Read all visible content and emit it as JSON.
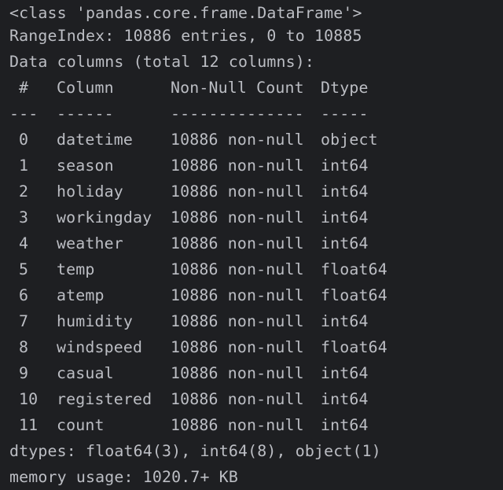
{
  "output": {
    "class_line": "<class 'pandas.core.frame.DataFrame'>",
    "range_index": "RangeIndex: 10886 entries, 0 to 10885",
    "data_columns": "Data columns (total 12 columns):",
    "headers": {
      "num": "#",
      "column": "Column",
      "count": "Non-Null Count",
      "dtype": "Dtype"
    },
    "separators": {
      "num": "---",
      "column": "------",
      "count": "--------------",
      "dtype": "-----"
    },
    "rows": [
      {
        "num": "0",
        "column": "datetime",
        "count": "10886 non-null",
        "dtype": "object"
      },
      {
        "num": "1",
        "column": "season",
        "count": "10886 non-null",
        "dtype": "int64"
      },
      {
        "num": "2",
        "column": "holiday",
        "count": "10886 non-null",
        "dtype": "int64"
      },
      {
        "num": "3",
        "column": "workingday",
        "count": "10886 non-null",
        "dtype": "int64"
      },
      {
        "num": "4",
        "column": "weather",
        "count": "10886 non-null",
        "dtype": "int64"
      },
      {
        "num": "5",
        "column": "temp",
        "count": "10886 non-null",
        "dtype": "float64"
      },
      {
        "num": "6",
        "column": "atemp",
        "count": "10886 non-null",
        "dtype": "float64"
      },
      {
        "num": "7",
        "column": "humidity",
        "count": "10886 non-null",
        "dtype": "int64"
      },
      {
        "num": "8",
        "column": "windspeed",
        "count": "10886 non-null",
        "dtype": "float64"
      },
      {
        "num": "9",
        "column": "casual",
        "count": "10886 non-null",
        "dtype": "int64"
      },
      {
        "num": "10",
        "column": "registered",
        "count": "10886 non-null",
        "dtype": "int64"
      },
      {
        "num": "11",
        "column": "count",
        "count": "10886 non-null",
        "dtype": "int64"
      }
    ],
    "dtypes_line": "dtypes: float64(3), int64(8), object(1)",
    "memory_line": "memory usage: 1020.7+ KB"
  },
  "colors": {
    "background": "#1e1f22",
    "text": "#bcbec4"
  }
}
